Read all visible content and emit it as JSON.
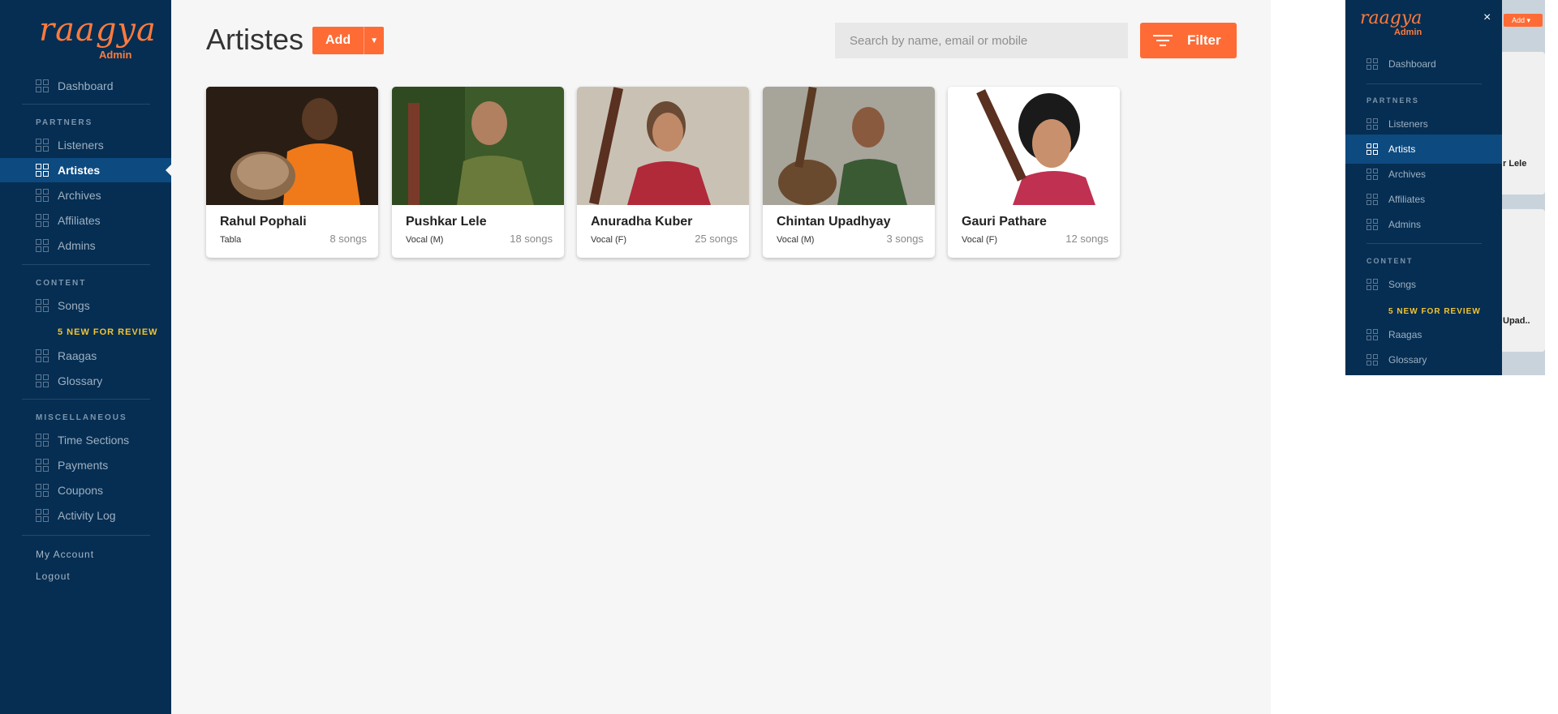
{
  "brand": {
    "name": "raagya",
    "subtitle": "Admin",
    "color": "#ff7a3d"
  },
  "sidebar": {
    "dashboard": "Dashboard",
    "sections": {
      "partners": "PARTNERS",
      "content": "CONTENT",
      "misc": "MISCELLANEOUS"
    },
    "items": {
      "listeners": "Listeners",
      "artistes": "Artistes",
      "archives": "Archives",
      "affiliates": "Affiliates",
      "admins": "Admins",
      "songs": "Songs",
      "review": "5 NEW FOR REVIEW",
      "raagas": "Raagas",
      "glossary": "Glossary",
      "time_sections": "Time Sections",
      "payments": "Payments",
      "coupons": "Coupons",
      "activity_log": "Activity Log"
    },
    "my_account": "My Account",
    "logout": "Logout",
    "active": "artistes"
  },
  "header": {
    "title": "Artistes",
    "add_label": "Add",
    "search_placeholder": "Search by name, email or mobile",
    "filter_label": "Filter"
  },
  "artists": [
    {
      "name": "Rahul Pophali",
      "role": "Tabla",
      "songs": "8 songs"
    },
    {
      "name": "Pushkar Lele",
      "role": "Vocal (M)",
      "songs": "18 songs"
    },
    {
      "name": "Anuradha Kuber",
      "role": "Vocal (F)",
      "songs": "25 songs"
    },
    {
      "name": "Chintan Upadhyay",
      "role": "Vocal (M)",
      "songs": "3 songs"
    },
    {
      "name": "Gauri Pathare",
      "role": "Vocal (F)",
      "songs": "12 songs"
    }
  ],
  "mobile": {
    "close": "×",
    "add_label": "Add",
    "dashboard": "Dashboard",
    "partners": "PARTNERS",
    "listeners": "Listeners",
    "artists": "Artists",
    "archives": "Archives",
    "affiliates": "Affiliates",
    "admins": "Admins",
    "content": "CONTENT",
    "songs": "Songs",
    "review": "5 NEW FOR REVIEW",
    "raagas": "Raagas",
    "glossary": "Glossary",
    "peek_1": "r Lele",
    "peek_2": "Upad.."
  },
  "colors": {
    "accent": "#ff6b35",
    "sidebar": "#052e52",
    "active": "#0d4a80",
    "review": "#f4c430"
  }
}
